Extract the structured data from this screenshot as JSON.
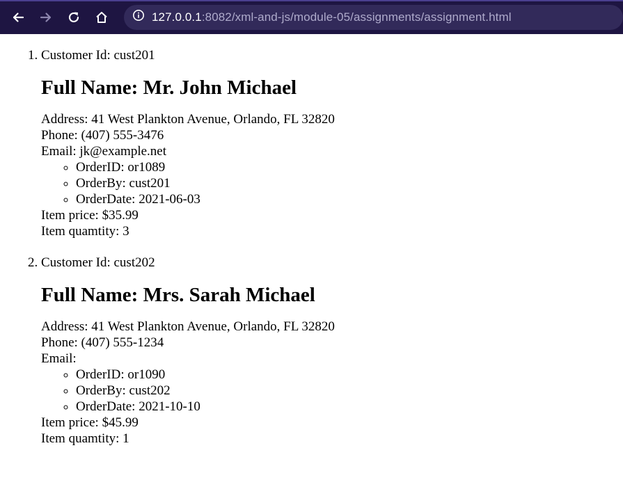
{
  "browser": {
    "url_host": "127.0.0.1",
    "url_rest": ":8082/xml-and-js/module-05/assignments/assignment.html",
    "icons": [
      "back-arrow-icon",
      "forward-arrow-icon",
      "reload-icon",
      "home-icon",
      "info-icon"
    ]
  },
  "customers": [
    {
      "customer_id": "Customer Id: cust201",
      "full_name": "Full Name: Mr. John Michael",
      "address": "Address: 41 West Plankton Avenue, Orlando, FL 32820",
      "phone": "Phone: (407) 555-3476",
      "email": "Email: jk@example.net",
      "orders": [
        "OrderID: or1089",
        "OrderBy: cust201",
        "OrderDate: 2021-06-03"
      ],
      "item_price": "Item price: $35.99",
      "item_quantity": "Item quamtity: 3"
    },
    {
      "customer_id": "Customer Id: cust202",
      "full_name": "Full Name: Mrs. Sarah Michael",
      "address": "Address: 41 West Plankton Avenue, Orlando, FL 32820",
      "phone": "Phone: (407) 555-1234",
      "email": "Email:",
      "orders": [
        "OrderID: or1090",
        "OrderBy: cust202",
        "OrderDate: 2021-10-10"
      ],
      "item_price": "Item price: $45.99",
      "item_quantity": "Item quamtity: 1"
    }
  ]
}
